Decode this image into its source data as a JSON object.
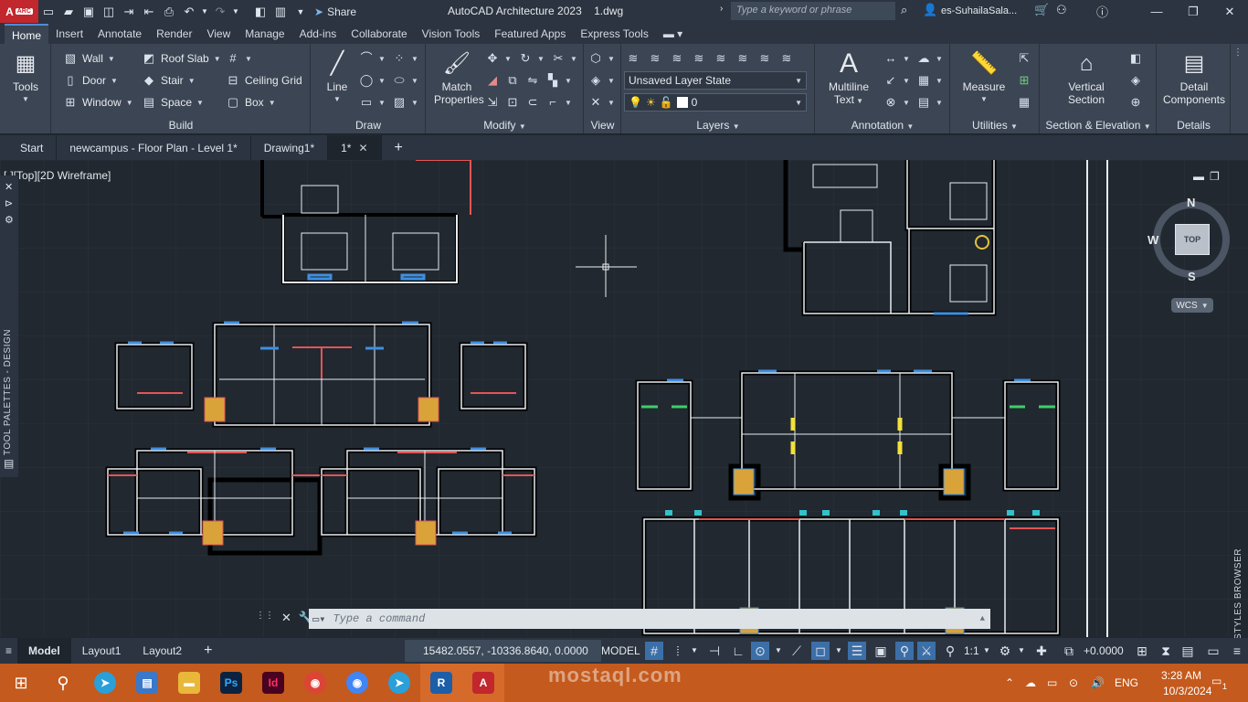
{
  "titlebar": {
    "app_badge": "A",
    "app_sub": "ARC",
    "share": "Share",
    "title_app": "AutoCAD Architecture 2023",
    "title_file": "1.dwg",
    "search_placeholder": "Type a keyword or phrase",
    "user": "es-SuhailaSala..."
  },
  "ribbon_tabs": [
    "Home",
    "Insert",
    "Annotate",
    "Render",
    "View",
    "Manage",
    "Add-ins",
    "Collaborate",
    "Vision Tools",
    "Featured Apps",
    "Express Tools"
  ],
  "ribbon": {
    "tools_label": "Tools",
    "build": {
      "title": "Build",
      "wall": "Wall",
      "door": "Door",
      "window": "Window",
      "roof_slab": "Roof Slab",
      "stair": "Stair",
      "space": "Space",
      "ceiling_grid": "Ceiling Grid",
      "box": "Box"
    },
    "draw": {
      "title": "Draw",
      "line": "Line"
    },
    "modify": {
      "title": "Modify",
      "match": "Match",
      "properties": "Properties"
    },
    "view": {
      "title": "View"
    },
    "layers": {
      "title": "Layers",
      "layer_state": "Unsaved Layer State",
      "layer_current": "0"
    },
    "annotation": {
      "title": "Annotation",
      "multiline": "Multiline",
      "text": "Text"
    },
    "utilities": {
      "title": "Utilities",
      "measure": "Measure"
    },
    "section": {
      "title": "Section & Elevation",
      "vertical": "Vertical",
      "section": "Section"
    },
    "details": {
      "title": "Details",
      "detail": "Detail",
      "components": "Components"
    }
  },
  "file_tabs": [
    {
      "label": "Start"
    },
    {
      "label": "newcampus - Floor Plan - Level 1*"
    },
    {
      "label": "Drawing1*"
    },
    {
      "label": "1*"
    }
  ],
  "viewport": {
    "label": "[-][Top][2D Wireframe]",
    "tool_palettes": "TOOL PALETTES - DESIGN",
    "styles_browser": "STYLES BROWSER",
    "compass": {
      "n": "N",
      "s": "S",
      "w": "W",
      "top": "TOP",
      "wcs": "WCS"
    }
  },
  "command": {
    "placeholder": "Type a command"
  },
  "layout_tabs": [
    "Model",
    "Layout1",
    "Layout2"
  ],
  "status": {
    "coords": "15482.0557, -10336.8640, 0.0000",
    "model": "MODEL",
    "scale": "1:1",
    "value": "+0.0000"
  },
  "taskbar": {
    "lang": "ENG",
    "time": "3:28 AM",
    "date": "10/3/2024",
    "notif": "1",
    "watermark": "mostaql.com"
  },
  "colors": {
    "accent": "#4a8ed6",
    "taskbar": "#c45a1d",
    "canvas": "#212830",
    "ribbon": "#3b4553"
  }
}
